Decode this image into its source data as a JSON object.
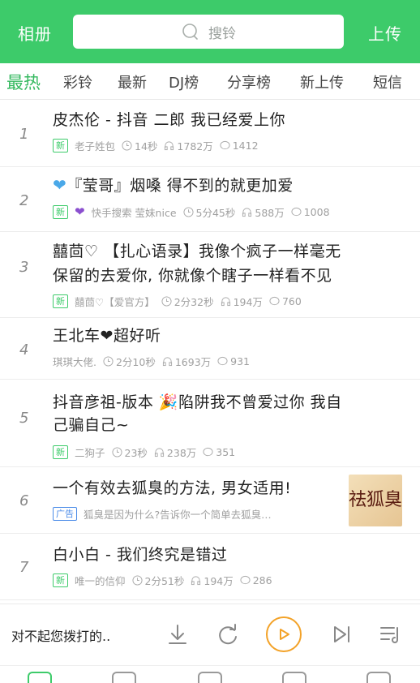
{
  "header": {
    "left_label": "相册",
    "search_placeholder": "搜铃",
    "right_label": "上传"
  },
  "tabs": [
    {
      "label": "最热",
      "active": true
    },
    {
      "label": "彩铃"
    },
    {
      "label": "最新"
    },
    {
      "label": "DJ榜"
    },
    {
      "label": "分享榜"
    },
    {
      "label": "新上传"
    },
    {
      "label": "短信"
    }
  ],
  "list": [
    {
      "rank": "1",
      "title": "皮杰伦 - 抖音 二郎 我已经爱上你",
      "badge": "新",
      "author": "老子姓包",
      "duration": "14秒",
      "plays": "1782万",
      "comments": "1412"
    },
    {
      "rank": "2",
      "title_prefix_icon": "blue-heart-icon",
      "title": "『莹哥』烟嗓  得不到的就更加爱",
      "badge": "新",
      "author_prefix_icon": "purple-heart-icon",
      "author": "快手搜索 莹妹nice",
      "duration": "5分45秒",
      "plays": "588万",
      "comments": "1008"
    },
    {
      "rank": "3",
      "title_line1": "囍茴♡   【扎心语录】我像个疯子一样毫无",
      "title_line2": "保留的去爱你, 你就像个瞎子一样看不见",
      "badge": "新",
      "author": "囍茴♡【爱官方】",
      "duration": "2分32秒",
      "plays": "194万",
      "comments": "760"
    },
    {
      "rank": "4",
      "title": "王北车",
      "title_suffix": "超好听",
      "author": "琪琪大佬.",
      "duration": "2分10秒",
      "plays": "1693万",
      "comments": "931"
    },
    {
      "rank": "5",
      "title_line1_a": "抖音彦祖-版本 ",
      "title_line1_b": "陷阱我不曾爱过你 我自",
      "title_line2": "己骗自己~",
      "badge": "新",
      "author": "二狗子",
      "duration": "23秒",
      "plays": "238万",
      "comments": "351"
    },
    {
      "rank": "6",
      "title": "一个有效去狐臭的方法, 男女适用!",
      "badge": "广告",
      "desc": "狐臭是因为什么?告诉你一个简单去狐臭…",
      "thumb_text": "祛狐臭"
    },
    {
      "rank": "7",
      "title": "白小白 - 我们终究是错过",
      "badge": "新",
      "author": "唯一的信仰",
      "duration": "2分51秒",
      "plays": "194万",
      "comments": "286"
    }
  ],
  "player": {
    "now_playing": "对不起您拨打的.."
  },
  "colors": {
    "brand_green": "#3dcb6a",
    "play_orange": "#f3a228",
    "ad_blue": "#4a8be8"
  }
}
